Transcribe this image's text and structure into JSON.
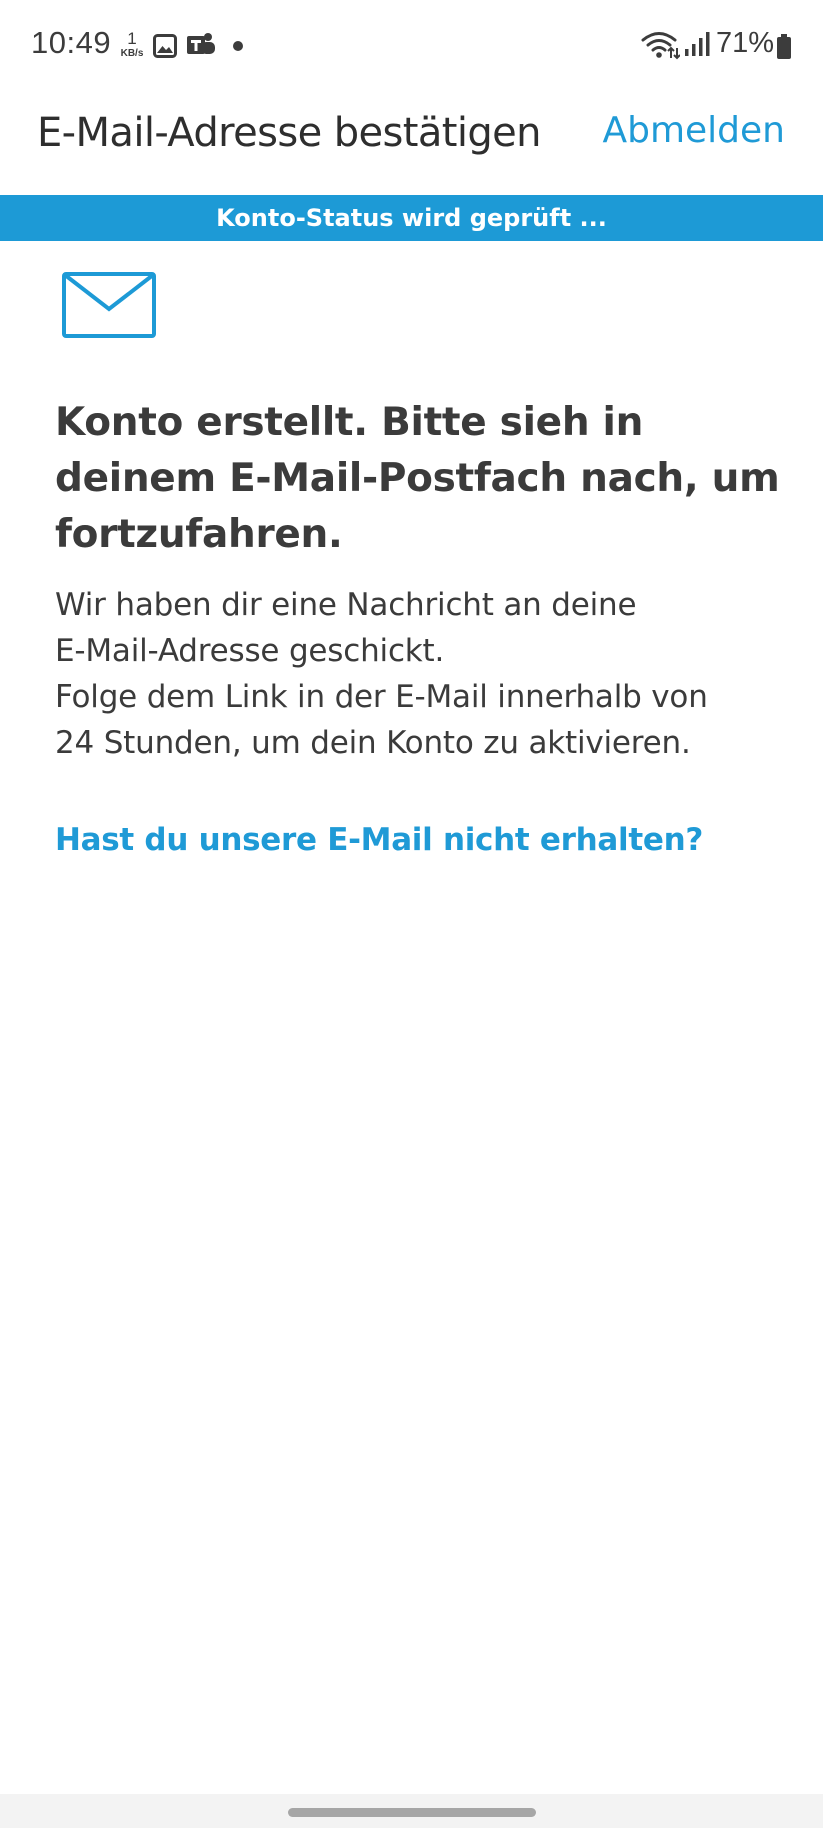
{
  "status_bar": {
    "time": "10:49",
    "net_speed_value": "1",
    "net_speed_unit": "KB/s",
    "battery": "71%",
    "icons": [
      "gallery-icon",
      "teams-icon",
      "wifi-icon",
      "signal-icon",
      "battery-icon"
    ]
  },
  "app_bar": {
    "title": "E-Mail-Adresse bestätigen",
    "sign_out_label": "Abmelden"
  },
  "banner": {
    "text": "Konto-Status wird geprüft ..."
  },
  "content": {
    "icon": "envelope-icon",
    "heading": "Konto erstellt. Bitte sieh in deinem E-Mail-Postfach nach, um fortzufahren.",
    "body_lines": [
      "Wir haben dir eine Nachricht an deine",
      "E-Mail-Adresse geschickt.",
      "Folge dem Link in der E-Mail innerhalb von",
      "24 Stunden, um dein Konto zu aktivieren."
    ],
    "resend_link": "Hast du unsere E-Mail nicht erhalten?"
  },
  "colors": {
    "accent": "#1d9ad6",
    "text": "#3b3b3b",
    "banner_text": "#ffffff"
  }
}
